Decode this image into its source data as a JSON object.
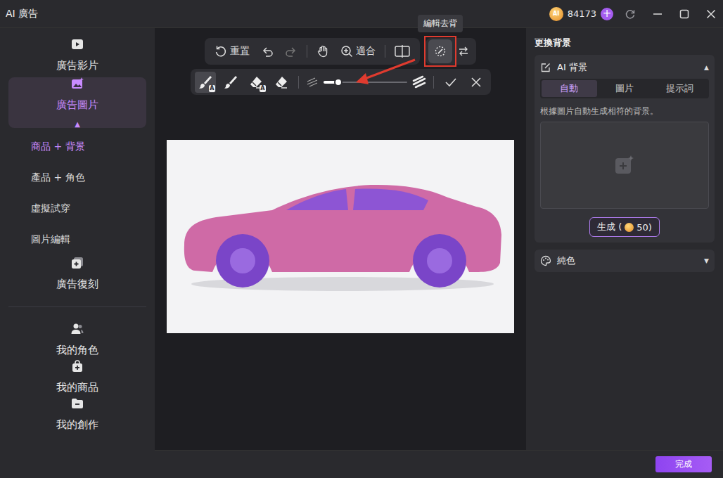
{
  "window": {
    "title": "AI 廣告",
    "coin": "AI",
    "credits": "84173",
    "add": "+"
  },
  "sidebar": {
    "sections": [
      [
        {
          "label": "廣告影片",
          "kind": "main",
          "selected": false
        },
        {
          "label": "廣告圖片",
          "kind": "main",
          "selected": true,
          "expanded": true,
          "arrow": "▲"
        },
        {
          "label": "商品 + 背景",
          "kind": "sub",
          "selected": true
        },
        {
          "label": "產品 + 角色",
          "kind": "sub",
          "selected": false
        },
        {
          "label": "虛擬試穿",
          "kind": "sub",
          "selected": false
        },
        {
          "label": "圖片編輯",
          "kind": "sub",
          "selected": false
        },
        {
          "label": "廣告復刻",
          "kind": "main",
          "selected": false
        }
      ],
      [
        {
          "label": "我的角色",
          "kind": "main",
          "selected": false
        },
        {
          "label": "我的商品",
          "kind": "main",
          "selected": false
        },
        {
          "label": "我的創作",
          "kind": "main",
          "selected": false
        }
      ]
    ]
  },
  "toolbar": {
    "reset": {
      "label": "重置"
    },
    "undo": {
      "disabled": false
    },
    "redo": {
      "disabled": true
    },
    "fit": {
      "label": "適合"
    },
    "edit_cutout": {
      "selected": true,
      "tooltip": "編輯去背"
    }
  },
  "brush_toolbar": {
    "tools": [
      {
        "kind": "brush",
        "badge": "A",
        "selected": true
      },
      {
        "kind": "brush",
        "selected": false
      },
      {
        "kind": "eraser",
        "badge": "A",
        "selected": false
      },
      {
        "kind": "eraser",
        "selected": false
      }
    ],
    "size": {
      "level": 0.18
    }
  },
  "panel": {
    "title": "更換背景",
    "ai_background": {
      "title": "AI 背景",
      "expanded": true,
      "arrow": "▲",
      "tabs": [
        {
          "label": "自動",
          "selected": true
        },
        {
          "label": "圖片",
          "selected": false
        },
        {
          "label": "提示詞",
          "selected": false
        }
      ],
      "description": "根據圖片自動生成相符的背景。",
      "generate": {
        "label": "生成 (",
        "cost": "50)"
      }
    },
    "solid": {
      "title": "純色",
      "expanded": false,
      "arrow": "▼"
    }
  },
  "footer": {
    "done": "完成"
  }
}
